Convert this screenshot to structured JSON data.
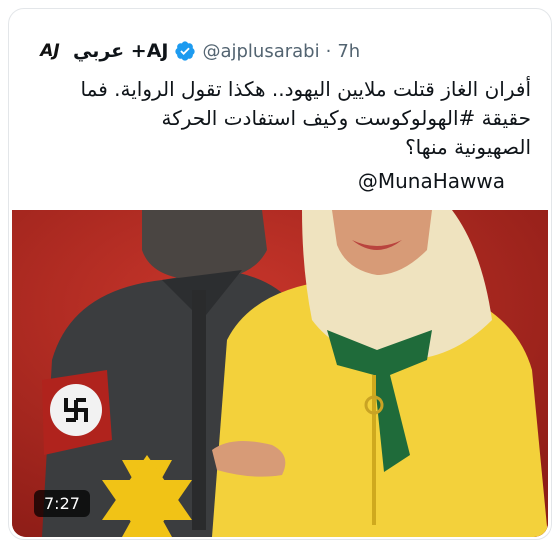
{
  "tweet": {
    "account_name": "عربي +AJ",
    "logo_text": "AJ",
    "handle": "@ajplusarabi",
    "separator": "·",
    "time": "7h",
    "verified_icon": "verified-badge-icon",
    "text_lines": [
      "أفران الغاز قتلت ملايين اليهود.. هكذا تقول الرواية. فما",
      "حقيقة #الهولوكوست وكيف استفادت الحركة",
      "الصهيونية منها؟"
    ],
    "mention": "@MunaHawwa"
  },
  "media": {
    "type": "video",
    "duration": "7:27",
    "background_color": "#b92b22",
    "jacket_color": "#f2d23a",
    "scarf_color": "#1f6b3a"
  }
}
